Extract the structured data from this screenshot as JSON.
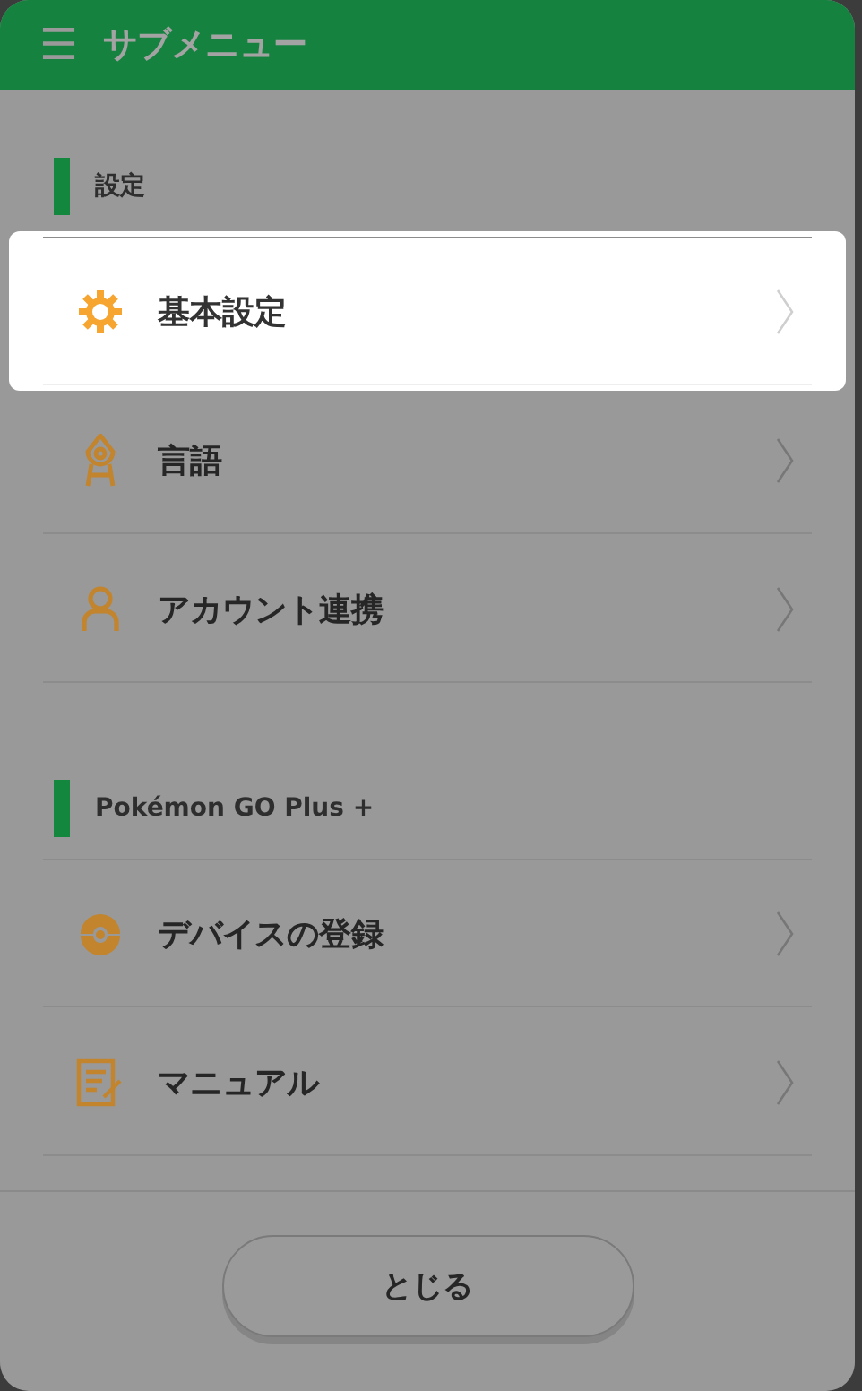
{
  "header": {
    "menu_icon": "☰",
    "title": "サブメニュー"
  },
  "sections": [
    {
      "title": "設定",
      "items": [
        {
          "label": "基本設定",
          "highlighted": true
        },
        {
          "label": "言語",
          "highlighted": false
        },
        {
          "label": "アカウント連携",
          "highlighted": false
        }
      ]
    },
    {
      "title": "Pokémon GO Plus +",
      "items": [
        {
          "label": "デバイスの登録",
          "highlighted": false
        },
        {
          "label": "マニュアル",
          "highlighted": false
        }
      ]
    }
  ],
  "close_button": "とじる"
}
